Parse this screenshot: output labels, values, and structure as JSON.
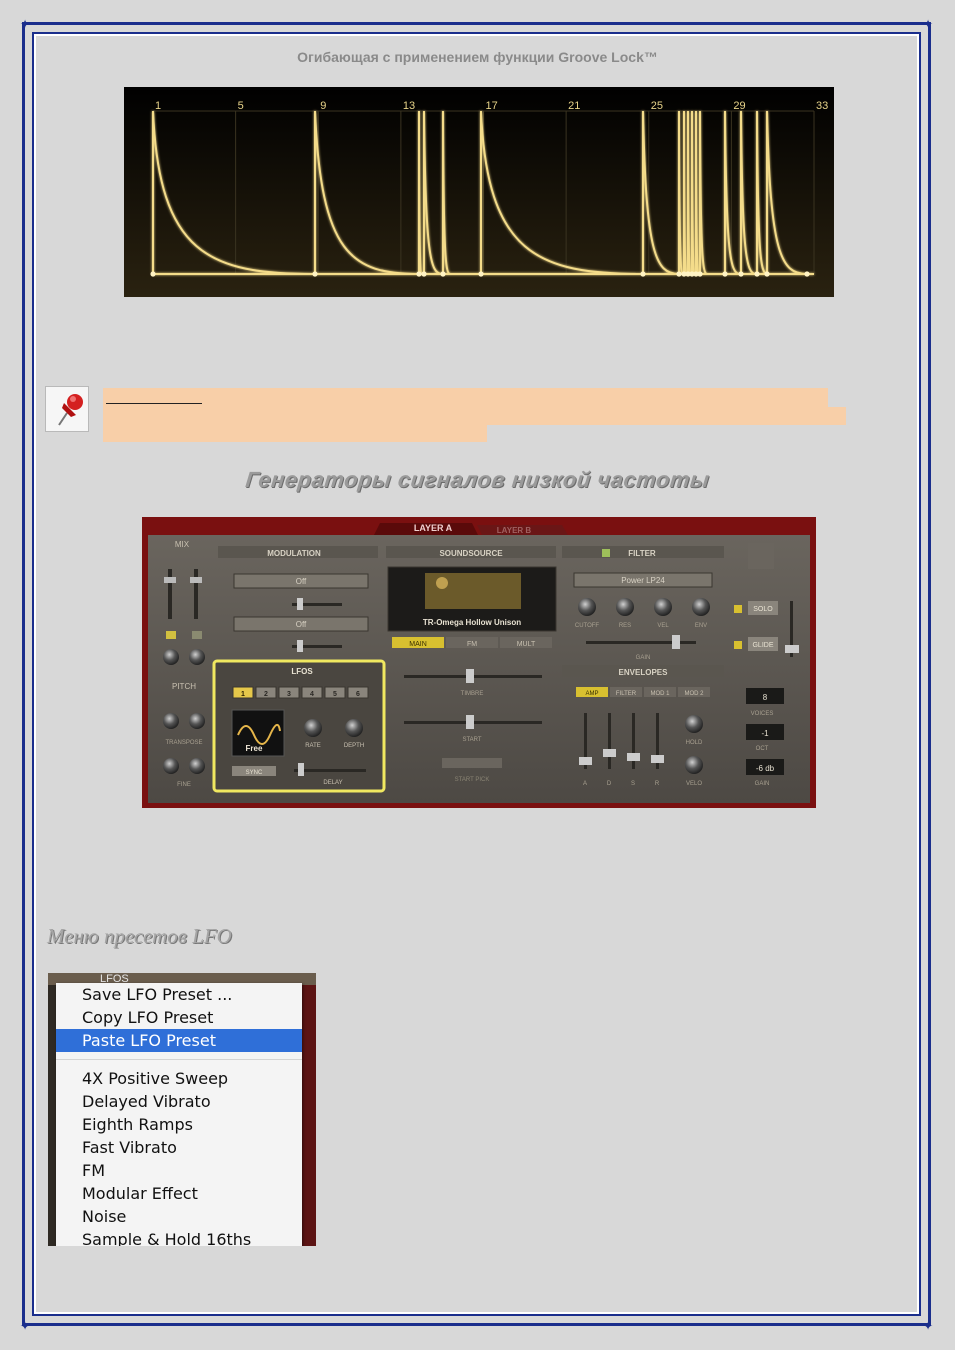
{
  "groove_title": "Огибающая с применением функции Groove Lock™",
  "envelope": {
    "markers": [
      "1",
      "5",
      "9",
      "13",
      "17",
      "21",
      "25",
      "29",
      "33"
    ],
    "colors": {
      "curve": "#f4dc8a",
      "bg": "#000000",
      "grid": "#2a2414"
    }
  },
  "note": {
    "icon": "pushpin-icon"
  },
  "lfo_heading": "Генераторы сигналов низкой частоты",
  "synth": {
    "tabs": [
      "LAYER A",
      "LAYER B"
    ],
    "mix_label": "MIX",
    "pitch_label": "PITCH",
    "transpose_label": "TRANSPOSE",
    "fine_label": "FINE",
    "modulation": {
      "title": "MODULATION",
      "slot1": "Off",
      "slot2": "Off"
    },
    "soundsource": {
      "title": "SOUNDSOURCE",
      "preset": "TR-Omega Hollow Unison",
      "tabs": [
        "MAIN",
        "FM",
        "MULT"
      ],
      "timbre": "TIMBRE",
      "start": "START",
      "start_pick": "START PICK"
    },
    "filter": {
      "title": "FILTER",
      "type": "Power LP24",
      "knobs": [
        "CUTOFF",
        "RES",
        "VEL",
        "ENV"
      ],
      "gain": "GAIN"
    },
    "envelopes": {
      "title": "ENVELOPES",
      "tabs": [
        "AMP",
        "FILTER",
        "MOD 1",
        "MOD 2"
      ],
      "sliders": [
        "A",
        "D",
        "S",
        "R"
      ],
      "hold": "HOLD",
      "velo": "VELO"
    },
    "lfos": {
      "title": "LFOS",
      "tabs": [
        "1",
        "2",
        "3",
        "4",
        "5",
        "6"
      ],
      "wave_label": "Free",
      "rate": "RATE",
      "depth": "DEPTH",
      "sync": "SYNC",
      "delay": "DELAY"
    },
    "right": {
      "solo": "SOLO",
      "glide": "GLIDE",
      "voices_value": "8",
      "voices": "VOICES",
      "oct_value": "-1",
      "oct": "OCT",
      "gain_value": "-6 db",
      "gain": "GAIN"
    },
    "colors": {
      "frame": "#7a1010",
      "panel": "#5b5650",
      "highlight": "#e8e06a",
      "accent": "#e6b64a"
    }
  },
  "menu_heading": "Меню пресетов LFO",
  "menu": {
    "background_label": "LFOS",
    "top_items": [
      "Save LFO Preset ...",
      "Copy LFO Preset",
      "Paste LFO Preset"
    ],
    "selected": "Paste LFO Preset",
    "presets": [
      "4X Positive Sweep",
      "Delayed Vibrato",
      "Eighth Ramps",
      "Fast Vibrato",
      "FM",
      "Modular Effect",
      "Noise",
      "Sample & Hold 16ths"
    ],
    "colors": {
      "selected": "#2f6fd8"
    }
  }
}
